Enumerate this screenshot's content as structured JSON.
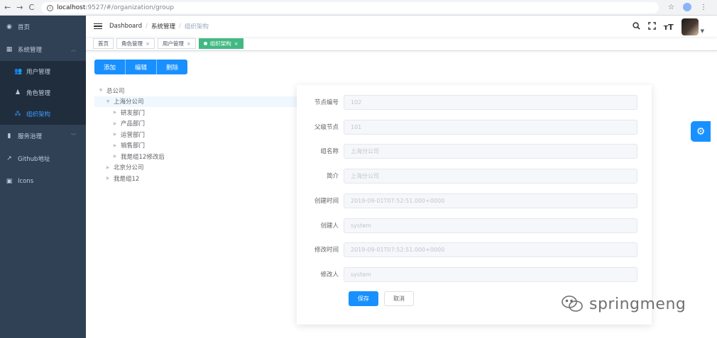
{
  "browser": {
    "back_icon": "←",
    "forward_icon": "→",
    "reload_icon": "C",
    "url_host": "localhost",
    "url_path": ":9527/#/organization/group"
  },
  "sidebar": {
    "items": [
      {
        "label": "首页",
        "icon": "dashboard-icon"
      },
      {
        "label": "系统管理",
        "icon": "grid-icon"
      },
      {
        "label": "服务治理",
        "icon": "bar-chart-icon"
      },
      {
        "label": "Github地址",
        "icon": "external-link-icon"
      },
      {
        "label": "Icons",
        "icon": "book-icon"
      }
    ],
    "submenu": [
      {
        "label": "用户管理",
        "icon": "users-icon"
      },
      {
        "label": "角色管理",
        "icon": "user-role-icon"
      },
      {
        "label": "组织架构",
        "icon": "org-tree-icon"
      }
    ],
    "accent": "#409eff",
    "background": "#304156"
  },
  "navbar": {
    "breadcrumb": [
      "Dashboard",
      "系统管理",
      "组织架构"
    ],
    "separator": "/"
  },
  "tags": [
    {
      "label": "首页",
      "closable": false
    },
    {
      "label": "角色管理",
      "closable": true
    },
    {
      "label": "用户管理",
      "closable": true
    },
    {
      "label": "组织架构",
      "closable": true,
      "active": true
    }
  ],
  "toolbar": {
    "add_label": "添加",
    "edit_label": "编辑",
    "delete_label": "删除"
  },
  "tree": {
    "nodes": [
      {
        "label": "总公司",
        "level": 0,
        "expanded": true
      },
      {
        "label": "上海分公司",
        "level": 1,
        "expanded": true,
        "current": true
      },
      {
        "label": "研发部门",
        "level": 2
      },
      {
        "label": "产品部门",
        "level": 2
      },
      {
        "label": "运营部门",
        "level": 2
      },
      {
        "label": "销售部门",
        "level": 2
      },
      {
        "label": "我是组12修改后",
        "level": 2
      },
      {
        "label": "北京分公司",
        "level": 1
      },
      {
        "label": "我是组12",
        "level": 1
      }
    ]
  },
  "form": {
    "fields": [
      {
        "label": "节点编号",
        "value": "102"
      },
      {
        "label": "父级节点",
        "value": "101"
      },
      {
        "label": "组名称",
        "value": "上海分公司"
      },
      {
        "label": "简介",
        "value": "上海分公司"
      },
      {
        "label": "创建时间",
        "value": "2019-09-01T07:52:51.000+0000"
      },
      {
        "label": "创建人",
        "value": "system"
      },
      {
        "label": "修改时间",
        "value": "2019-09-01T07:52:51.000+0000"
      },
      {
        "label": "修改人",
        "value": "system"
      }
    ],
    "save_label": "保存",
    "cancel_label": "取消"
  },
  "watermark": {
    "text": "springmeng"
  }
}
